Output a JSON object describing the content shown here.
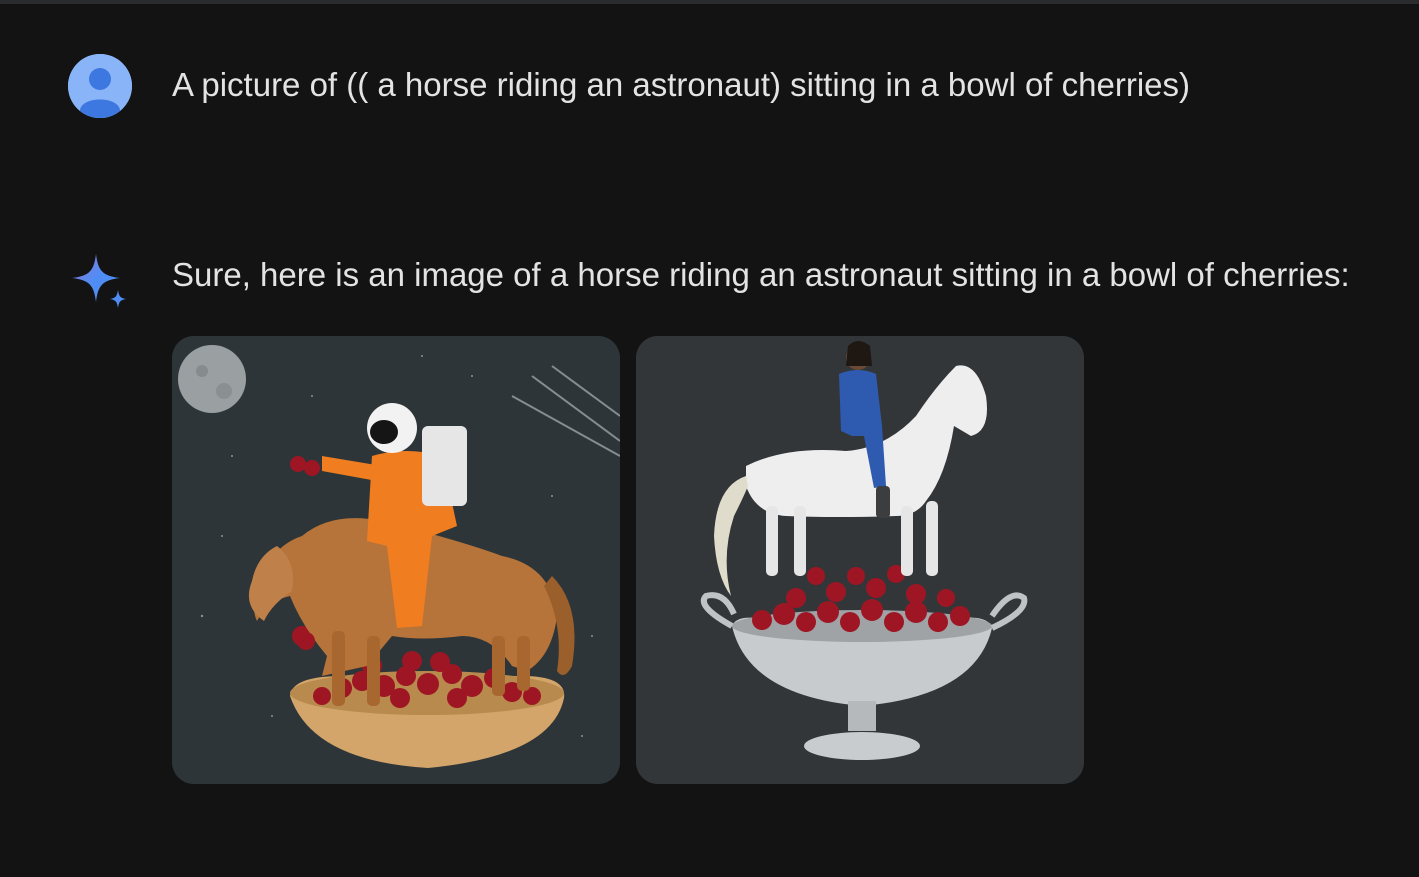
{
  "conversation": {
    "user_turn": {
      "avatar_icon": "account-circle-icon",
      "prompt": "A picture of (( a horse riding an astronaut) sitting in a bowl of cherries)"
    },
    "model_turn": {
      "icon": "sparkle-icon",
      "reply": "Sure, here is an image of a horse riding an astronaut sitting in a bowl of cherries:",
      "images": [
        {
          "subject": "astronaut in orange suit riding brown horse in wooden bowl of cherries"
        },
        {
          "subject": "woman in blue flight suit riding white horse on silver bowl of cherries"
        }
      ]
    }
  },
  "colors": {
    "background": "#131314",
    "text": "#e3e3e3",
    "avatar": "#8ab4f8",
    "sparkle_blue": "#4f8df5"
  }
}
